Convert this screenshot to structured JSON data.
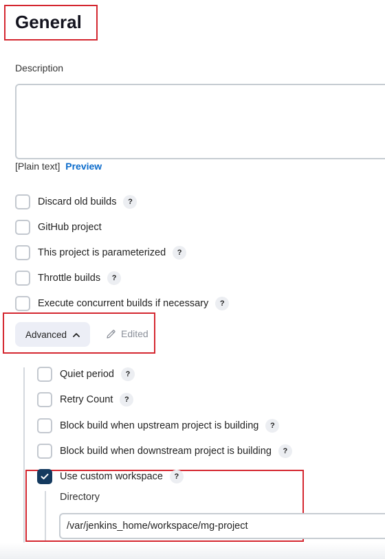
{
  "general": {
    "title": "General",
    "description_label": "Description",
    "description_value": "",
    "plain_text_label": "[Plain text]",
    "preview_link": "Preview"
  },
  "options": [
    {
      "label": "Discard old builds",
      "checked": false,
      "help": "?"
    },
    {
      "label": "GitHub project",
      "checked": false
    },
    {
      "label": "This project is parameterized",
      "checked": false,
      "help": "?"
    },
    {
      "label": "Throttle builds",
      "checked": false,
      "help": "?"
    },
    {
      "label": "Execute concurrent builds if necessary",
      "checked": false,
      "help": "?"
    }
  ],
  "advanced": {
    "button_label": "Advanced",
    "edited_label": "Edited"
  },
  "advanced_options": [
    {
      "label": "Quiet period",
      "checked": false,
      "help": "?"
    },
    {
      "label": "Retry Count",
      "checked": false,
      "help": "?"
    },
    {
      "label": "Block build when upstream project is building",
      "checked": false,
      "help": "?"
    },
    {
      "label": "Block build when downstream project is building",
      "checked": false,
      "help": "?"
    },
    {
      "label": "Use custom workspace",
      "checked": true,
      "help": "?"
    }
  ],
  "workspace": {
    "directory_label": "Directory",
    "directory_value": "/var/jenkins_home/workspace/mg-project"
  },
  "colors": {
    "highlight": "#d4262f",
    "link": "#0b6bcb",
    "checked": "#143a5f"
  }
}
